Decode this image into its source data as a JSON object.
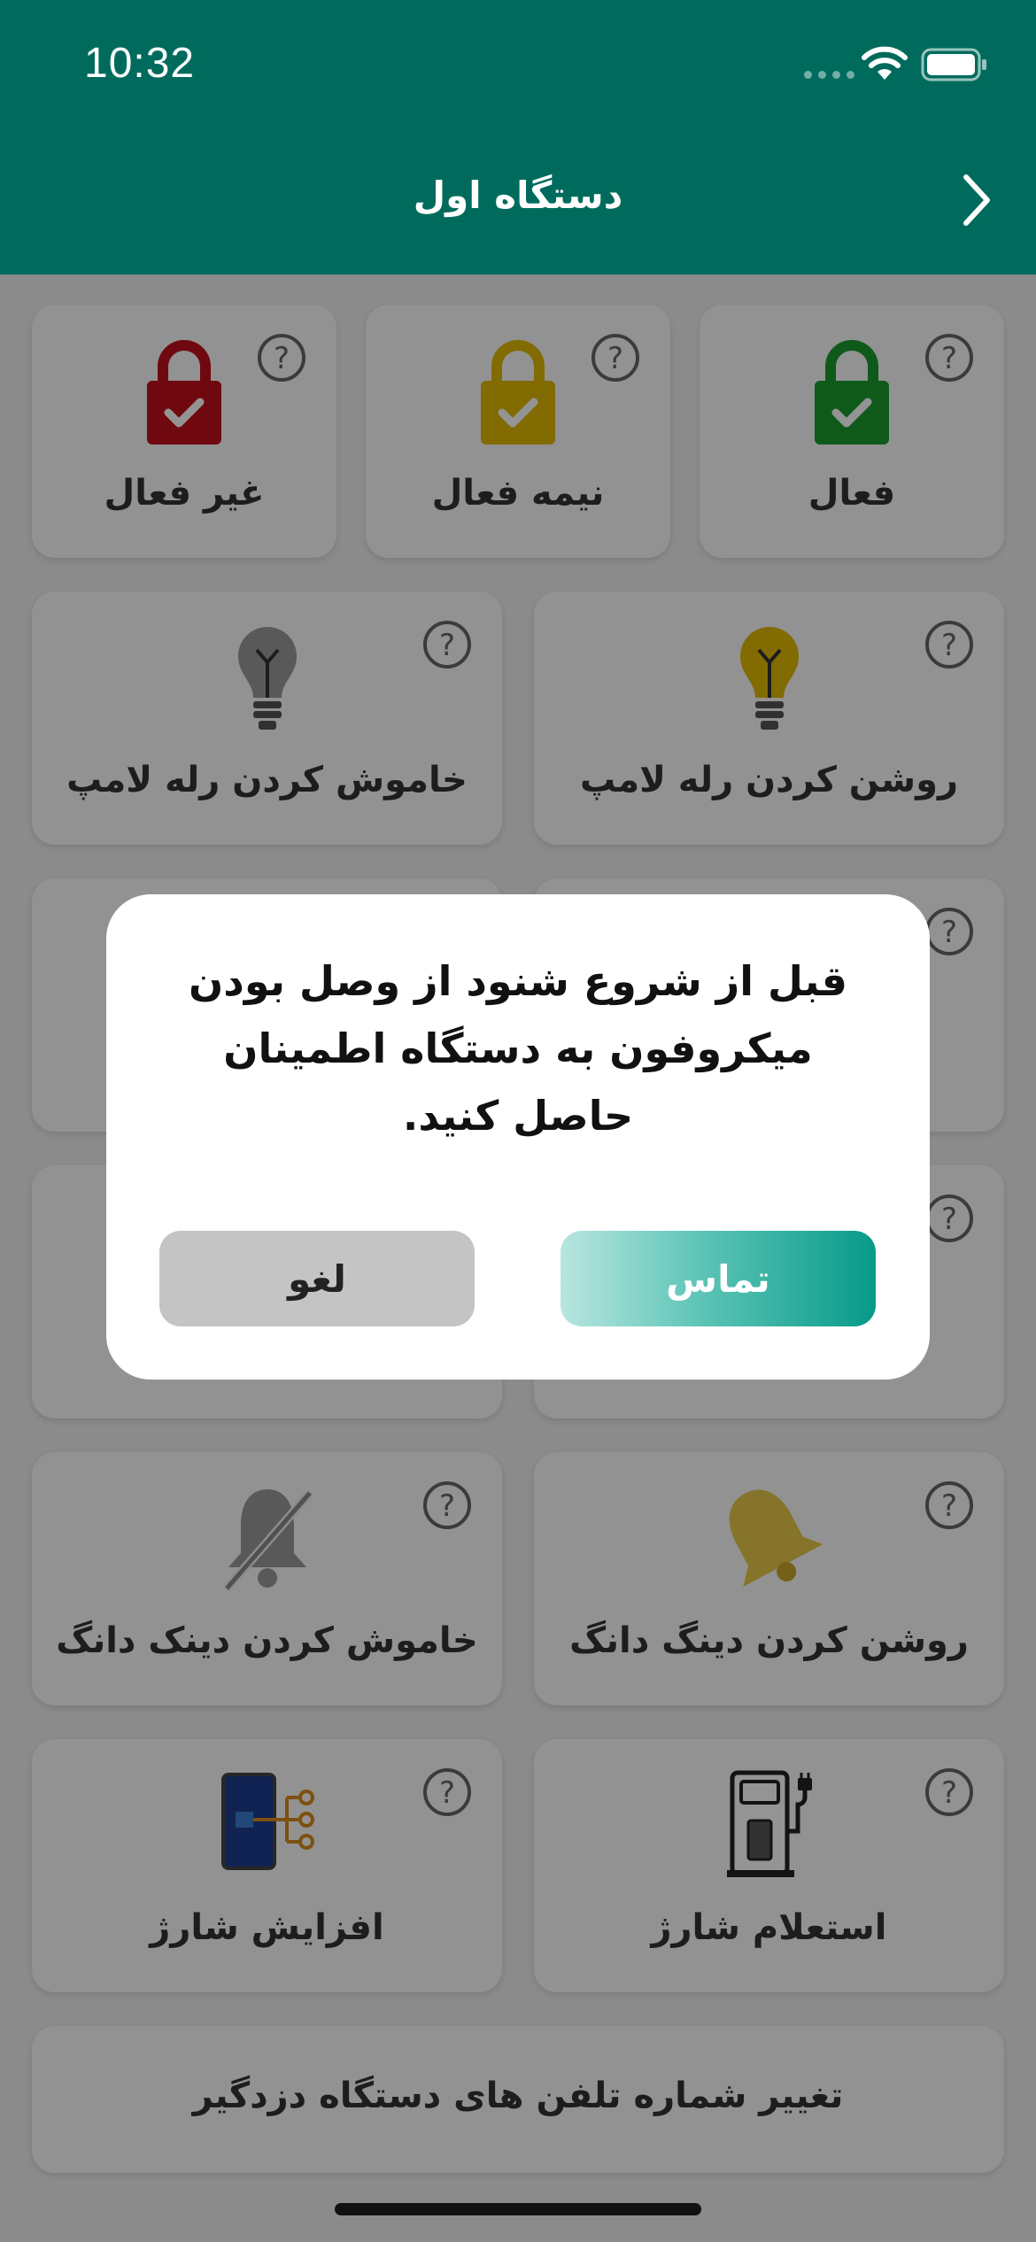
{
  "status_bar": {
    "time": "10:32"
  },
  "nav": {
    "title": "دستگاه اول"
  },
  "security_cards": [
    {
      "label": "فعال",
      "color": "#1a9b2e"
    },
    {
      "label": "نیمه فعال",
      "color": "#e0b800"
    },
    {
      "label": "غیر فعال",
      "color": "#c0101b"
    }
  ],
  "cards": {
    "lamp_on": "روشن کردن رله لامپ",
    "lamp_off": "خاموش کردن رله لامپ",
    "bell_on": "روشن کردن دینگ دانگ",
    "bell_off": "خاموش کردن دینک دانگ",
    "charge_inquiry": "استعلام شارژ",
    "charge_increase": "افزایش شارژ",
    "change_phones": "تغییر شماره تلفن های دستگاه دزدگیر"
  },
  "help_symbol": "?",
  "modal": {
    "message": "قبل از شروع شنود از وصل بودن میکروفون به دستگاه اطمینان حاصل کنید.",
    "call_label": "تماس",
    "cancel_label": "لغو"
  },
  "colors": {
    "brand": "#006b5d",
    "accent": "#079a89"
  }
}
